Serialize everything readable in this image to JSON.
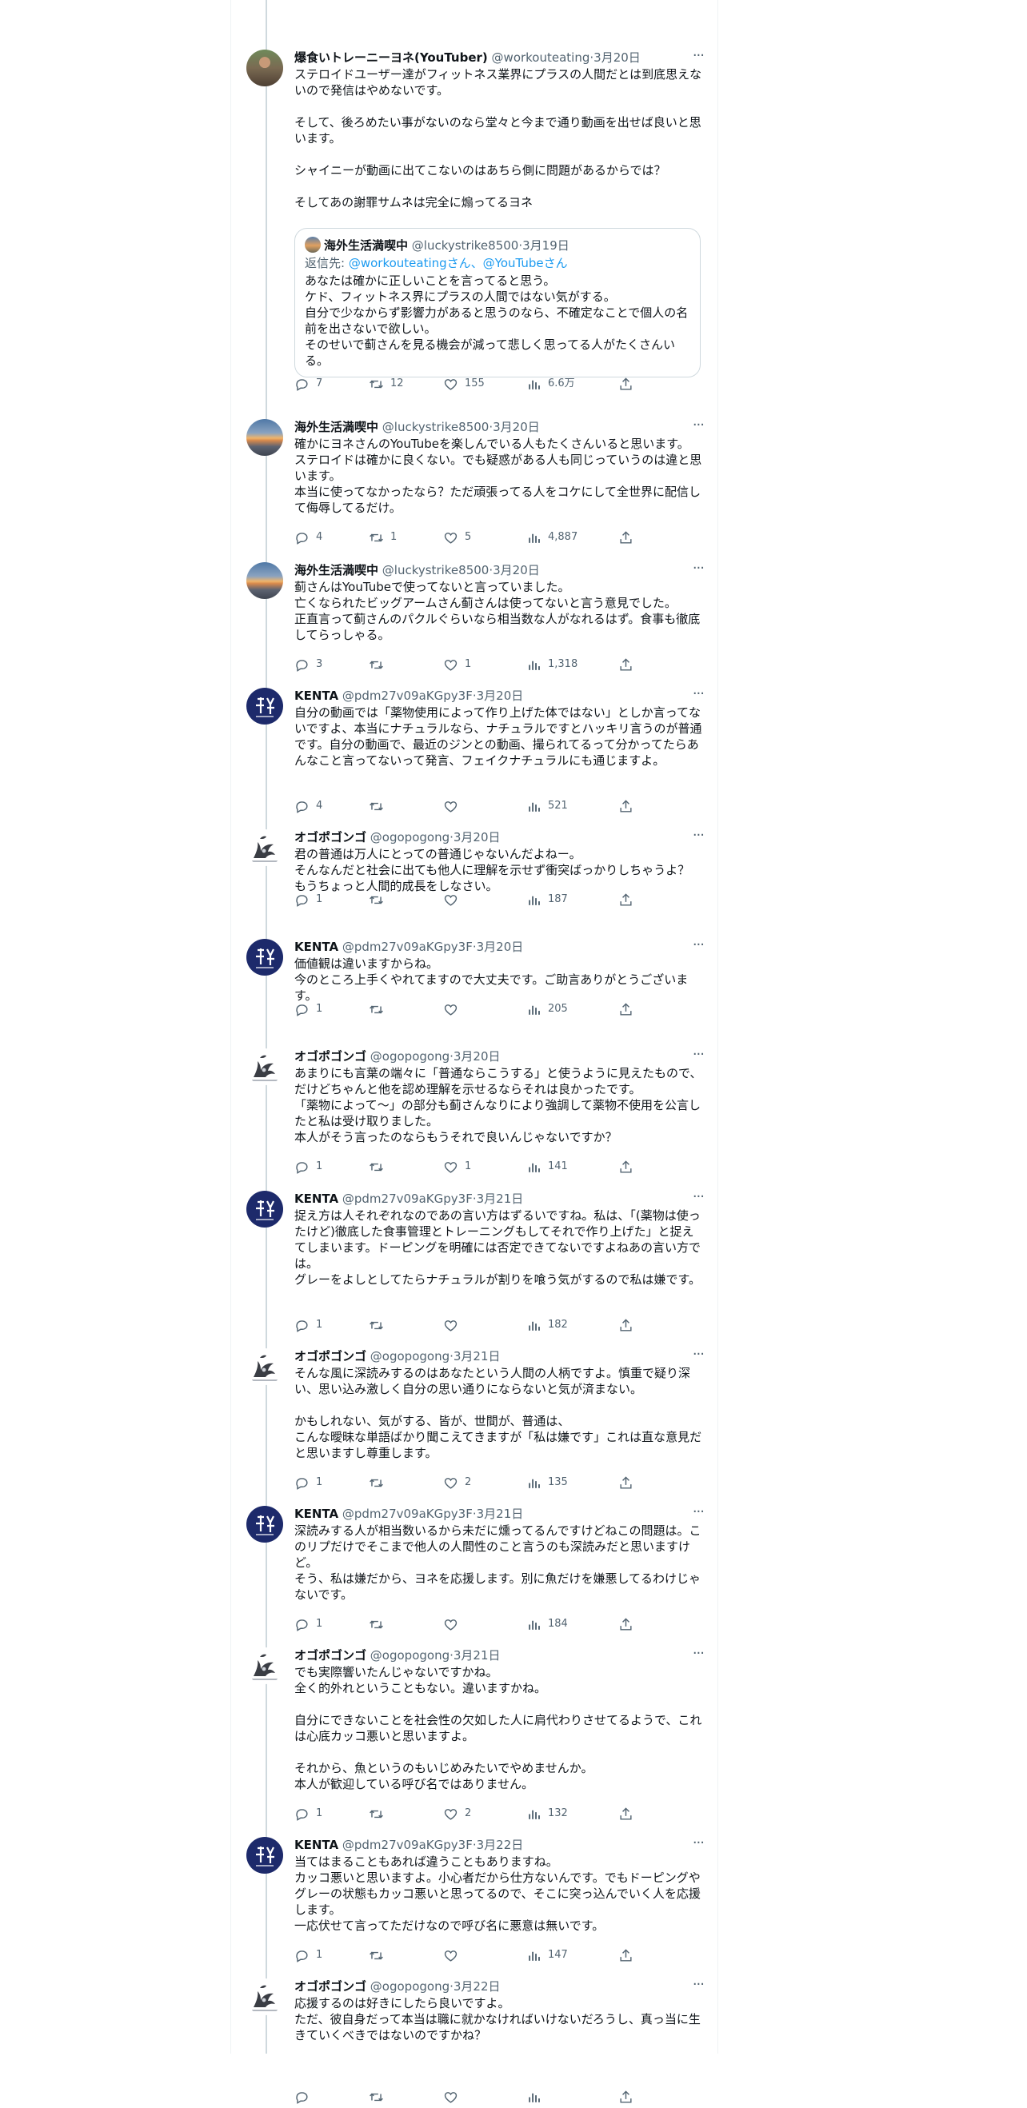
{
  "more_label": "···",
  "tweets": [
    {
      "name": "爆食いトレーニーヨネ(YouTuber)",
      "handle": "@workouteating",
      "date": "3月20日",
      "text": "ステロイドユーザー達がフィットネス業界にプラスの人間だとは到底思えないので発信はやめないです。\n\nそして、後ろめたい事がないのなら堂々と今まで通り動画を出せば良いと思います。\n\nシャイニーが動画に出てこないのはあちら側に問題があるからでは？\n\nそしてあの謝罪サムネは完全に煽ってるヨネ",
      "quote": {
        "name": "海外生活満喫中",
        "handle": "@luckystrike8500",
        "date": "3月19日",
        "reply_prefix": "返信先: ",
        "reply_to": "@workouteatingさん、@YouTubeさん",
        "text": "あなたは確かに正しいことを言ってると思う。\nケド、フィットネス界にプラスの人間ではない気がする。\n自分で少なからず影響力があると思うのなら、不確定なことで個人の名前を出さないで欲しい。\nそのせいで蓟さんを見る機会が減って悲しく思ってる人がたくさんいる。"
      },
      "counts": {
        "reply": "7",
        "retweet": "12",
        "like": "155",
        "views": "6.6万"
      }
    },
    {
      "name": "海外生活満喫中",
      "handle": "@luckystrike8500",
      "date": "3月20日",
      "text": "確かにヨネさんのYouTubeを楽しんでいる人もたくさんいると思います。\nステロイドは確かに良くない。でも疑惑がある人も同じっていうのは違と思います。\n本当に使ってなかったなら？ただ頑張ってる人をコケにして全世界に配信して侮辱してるだけ。",
      "counts": {
        "reply": "4",
        "retweet": "1",
        "like": "5",
        "views": "4,887"
      }
    },
    {
      "name": "海外生活満喫中",
      "handle": "@luckystrike8500",
      "date": "3月20日",
      "text": "蓟さんはYouTubeで使ってないと言っていました。\n亡くなられたビッグアームさん蓟さんは使ってないと言う意見でした。\n正直言って蓟さんのパクルぐらいなら相当数な人がなれるはず。食事も徹底してらっしゃる。",
      "counts": {
        "reply": "3",
        "retweet": "",
        "like": "1",
        "views": "1,318"
      }
    },
    {
      "name": "KENTA",
      "handle": "@pdm27v09aKGpy3F",
      "date": "3月20日",
      "text": "自分の動画では「薬物使用によって作り上げた体ではない」としか言ってないですよ、本当にナチュラルなら、ナチュラルですとハッキリ言うのが普通です。自分の動画で、最近のジンとの動画、撮られてるって分かってたらあんなこと言ってないって発言、フェイクナチュラルにも通じますよ。",
      "counts": {
        "reply": "4",
        "retweet": "",
        "like": "",
        "views": "521"
      }
    },
    {
      "name": "オゴポゴンゴ",
      "handle": "@ogopogong",
      "date": "3月20日",
      "text": "君の普通は万人にとっての普通じゃないんだよねー。\nそんなんだと社会に出ても他人に理解を示せず衝突ばっかりしちゃうよ？\nもうちょっと人間的成長をしなさい。",
      "counts": {
        "reply": "1",
        "retweet": "",
        "like": "",
        "views": "187"
      }
    },
    {
      "name": "KENTA",
      "handle": "@pdm27v09aKGpy3F",
      "date": "3月20日",
      "text": "価値観は違いますからね。\n今のところ上手くやれてますので大丈夫です。ご助言ありがとうございます。",
      "counts": {
        "reply": "1",
        "retweet": "",
        "like": "",
        "views": "205"
      }
    },
    {
      "name": "オゴポゴンゴ",
      "handle": "@ogopogong",
      "date": "3月20日",
      "text": "あまりにも言葉の端々に「普通ならこうする」と使うように見えたもので、だけどちゃんと他を認め理解を示せるならそれは良かったです。\n「薬物によって～」の部分も蓟さんなりにより強調して薬物不使用を公言したと私は受け取りました。\n本人がそう言ったのならもうそれで良いんじゃないですか？",
      "counts": {
        "reply": "1",
        "retweet": "",
        "like": "1",
        "views": "141"
      }
    },
    {
      "name": "KENTA",
      "handle": "@pdm27v09aKGpy3F",
      "date": "3月21日",
      "text": "捉え方は人それぞれなのであの言い方はずるいですね。私は、「(薬物は使ったけど)徹底した食事管理とトレーニングもしてそれで作り上げた」と捉えてしまいます。ドーピングを明確には否定できてないですよねあの言い方では。\nグレーをよしとしてたらナチュラルが割りを喰う気がするので私は嫌です。",
      "counts": {
        "reply": "1",
        "retweet": "",
        "like": "",
        "views": "182"
      }
    },
    {
      "name": "オゴポゴンゴ",
      "handle": "@ogopogong",
      "date": "3月21日",
      "text": "そんな風に深読みするのはあなたという人間の人柄ですよ。慎重で疑り深い、思い込み激しく自分の思い通りにならないと気が済まない。\n\nかもしれない、気がする、皆が、世間が、普通は、\nこんな曖昧な単語ばかり聞こえてきますが「私は嫌です」これは直な意見だと思いますし尊重します。",
      "counts": {
        "reply": "1",
        "retweet": "",
        "like": "2",
        "views": "135"
      }
    },
    {
      "name": "KENTA",
      "handle": "@pdm27v09aKGpy3F",
      "date": "3月21日",
      "text": "深読みする人が相当数いるから未だに燻ってるんですけどねこの問題は。このリプだけでそこまで他人の人間性のこと言うのも深読みだと思いますけど。\nそう、私は嫌だから、ヨネを応援します。別に魚だけを嫌悪してるわけじゃないです。",
      "counts": {
        "reply": "1",
        "retweet": "",
        "like": "",
        "views": "184"
      }
    },
    {
      "name": "オゴポゴンゴ",
      "handle": "@ogopogong",
      "date": "3月21日",
      "text": "でも実際響いたんじゃないですかね。\n全く的外れということもない。違いますかね。\n\n自分にできないことを社会性の欠如した人に肩代わりさせてるようで、これは心底カッコ悪いと思いますよ。\n\nそれから、魚というのもいじめみたいでやめませんか。\n本人が歓迎している呼び名ではありません。",
      "counts": {
        "reply": "1",
        "retweet": "",
        "like": "2",
        "views": "132"
      }
    },
    {
      "name": "KENTA",
      "handle": "@pdm27v09aKGpy3F",
      "date": "3月22日",
      "text": "当てはまることもあれば違うこともありますね。\nカッコ悪いと思いますよ。小心者だから仕方ないんです。でもドーピングやグレーの状態もカッコ悪いと思ってるので、そこに突っ込んでいく人を応援します。\n一応伏せて言ってただけなので呼び名に悪意は無いです。",
      "counts": {
        "reply": "1",
        "retweet": "",
        "like": "",
        "views": "147"
      }
    },
    {
      "name": "オゴポゴンゴ",
      "handle": "@ogopogong",
      "date": "3月22日",
      "text": "応援するのは好きにしたら良いですよ。\nただ、彼自身だって本当は職に就かなければいけないだろうし、真っ当に生きていくべきではないのですかね？",
      "counts": {
        "reply": "",
        "retweet": "",
        "like": "",
        "views": ""
      }
    }
  ]
}
